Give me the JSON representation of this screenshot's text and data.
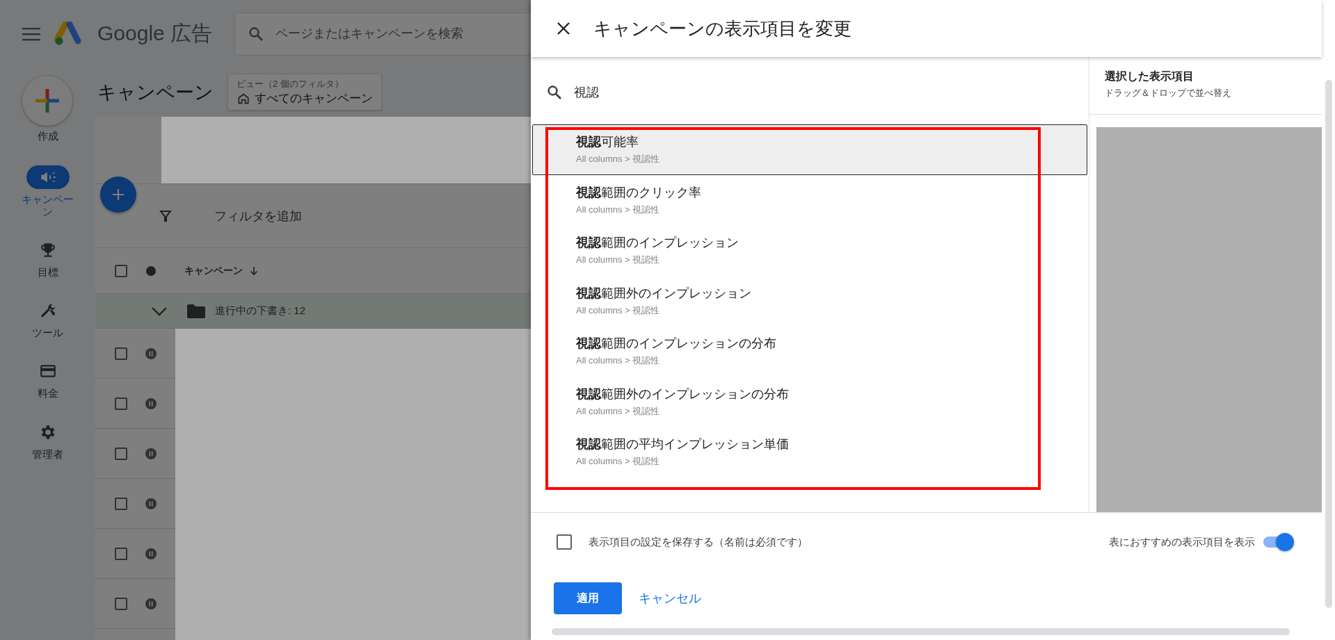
{
  "app": {
    "brand": "Google 広告",
    "search": {
      "placeholder": "ページまたはキャンペーンを検索"
    }
  },
  "nav": {
    "create_label": "作成",
    "items": [
      {
        "kind": "campaigns",
        "label": "キャンペーン",
        "selected": true
      },
      {
        "kind": "goals",
        "label": "目標",
        "selected": false
      },
      {
        "kind": "tools",
        "label": "ツール",
        "selected": false
      },
      {
        "kind": "billing",
        "label": "料金",
        "selected": false
      },
      {
        "kind": "admin",
        "label": "管理者",
        "selected": false
      }
    ]
  },
  "page": {
    "title": "キャンペーン",
    "view": {
      "caption": "ビュー（2 個のフィルタ）",
      "name": "すべてのキャンペーン"
    },
    "filter_label": "フィルタを追加",
    "table": {
      "header_checked": false,
      "column": "キャンペーン",
      "draft_group": "進行中の下書き: 12",
      "rows": [
        {
          "checked": false,
          "paused": true
        },
        {
          "checked": false,
          "paused": true
        },
        {
          "checked": false,
          "paused": true
        },
        {
          "checked": false,
          "paused": true
        },
        {
          "checked": false,
          "paused": true
        },
        {
          "checked": false,
          "paused": true
        }
      ]
    }
  },
  "panel": {
    "title": "キャンペーンの表示項目を変更",
    "search_value": "視認",
    "results": [
      {
        "title": "**視認**可能率",
        "path": "All columns > 視認性",
        "selected": true
      },
      {
        "title": "**視認**範囲のクリック率",
        "path": "All columns > 視認性",
        "selected": false
      },
      {
        "title": "**視認**範囲のインプレッション",
        "path": "All columns > 視認性",
        "selected": false
      },
      {
        "title": "**視認**範囲外のインプレッション",
        "path": "All columns > 視認性",
        "selected": false
      },
      {
        "title": "**視認**範囲のインプレッションの分布",
        "path": "All columns > 視認性",
        "selected": false
      },
      {
        "title": "**視認**範囲外のインプレッションの分布",
        "path": "All columns > 視認性",
        "selected": false
      },
      {
        "title": "**視認**範囲の平均インプレッション単価",
        "path": "All columns > 視認性",
        "selected": false
      }
    ],
    "selected_columns": {
      "title": "選択した表示項目",
      "hint": "ドラッグ＆ドロップで並べ替え"
    },
    "save_option": {
      "label": "表示項目の設定を保存する（名前は必須です）",
      "checked": false
    },
    "recommend_toggle": {
      "label": "表におすすめの表示項目を表示",
      "on": true
    },
    "buttons": {
      "apply": "適用",
      "cancel": "キャンセル"
    }
  }
}
